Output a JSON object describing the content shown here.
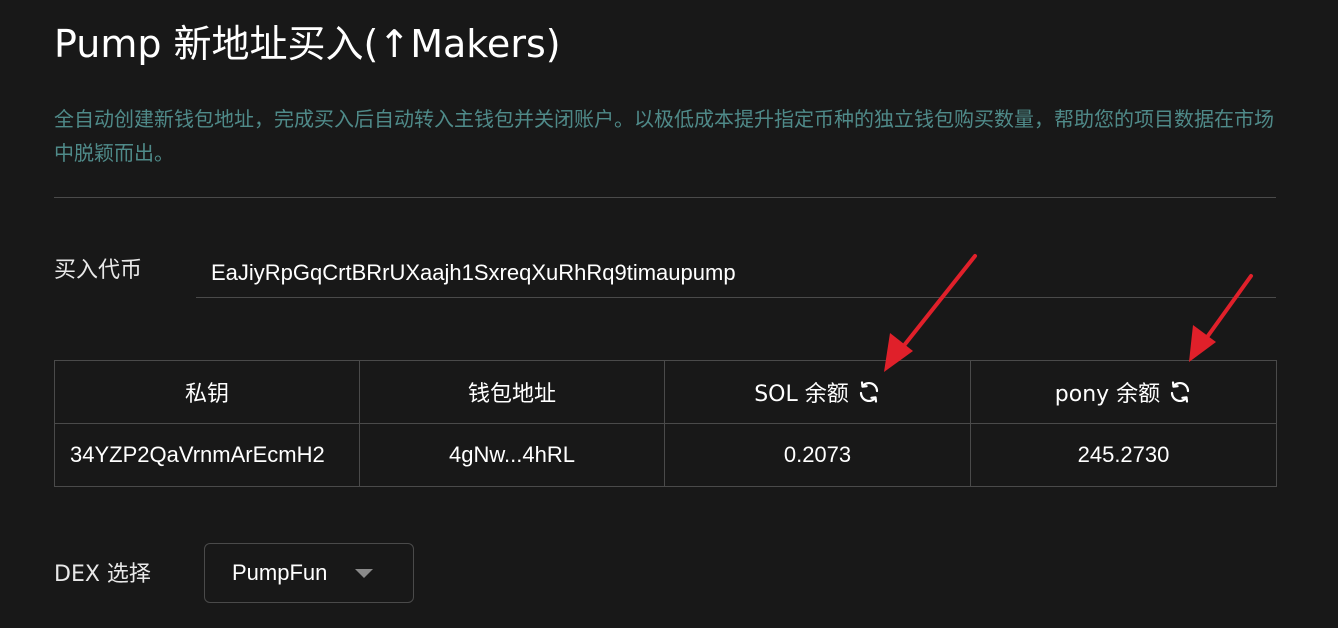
{
  "header": {
    "title": "Pump 新地址买入(↑Makers)",
    "description": "全自动创建新钱包地址，完成买入后自动转入主钱包并关闭账户。以极低成本提升指定币种的独立钱包购买数量，帮助您的项目数据在市场中脱颖而出。"
  },
  "token": {
    "label": "买入代币",
    "value": "EaJiyRpGqCrtBRrUXaajh1SxreqXuRhRq9timaupump"
  },
  "table": {
    "columns": [
      "私钥",
      "钱包地址",
      "SOL 余额",
      "pony 余额"
    ],
    "rows": [
      {
        "private_key": "34YZP2QaVrnmArEcmH2",
        "address": "4gNw...4hRL",
        "sol_balance": "0.2073",
        "pony_balance": "245.2730"
      }
    ]
  },
  "dex": {
    "label": "DEX 选择",
    "selected": "PumpFun"
  },
  "colors": {
    "background": "#181818",
    "description": "#4f8a89",
    "border": "#4a4a4a",
    "annotation_arrow": "#e0202a"
  },
  "icons": [
    "refresh-icon",
    "caret-down-icon",
    "annotation-arrow"
  ]
}
